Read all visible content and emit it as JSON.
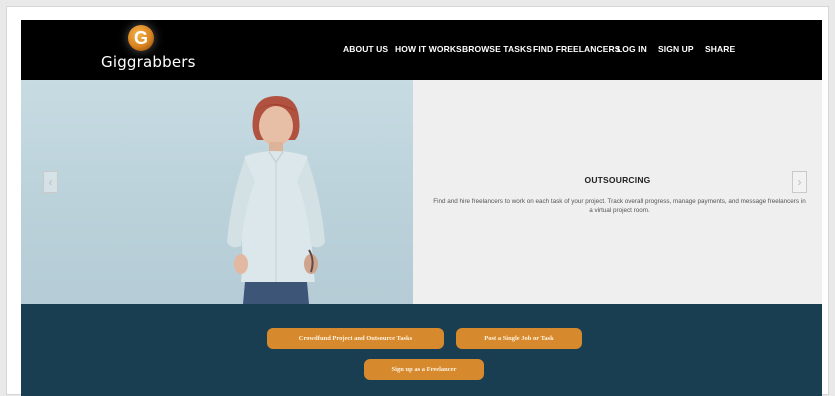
{
  "brand": {
    "logo_letter": "G",
    "name": "Giggrabbers"
  },
  "nav": {
    "items": [
      {
        "label": "ABOUT US"
      },
      {
        "label": "HOW IT WORKS"
      },
      {
        "label": "BROWSE TASKS"
      },
      {
        "label": "FIND FREELANCERS"
      },
      {
        "label": "LOG IN"
      },
      {
        "label": "SIGN UP"
      },
      {
        "label": "SHARE"
      }
    ]
  },
  "hero": {
    "title": "OUTSOURCING",
    "description": "Find and hire freelancers to work on each task of your project. Track overall progress, manage payments, and message freelancers in a virtual project room.",
    "prev_icon": "chevron-left-icon",
    "next_icon": "chevron-right-icon",
    "prev_glyph": "‹",
    "next_glyph": "›"
  },
  "cta": {
    "crowdfund": "Crowdfund Project and Outsource Tasks",
    "single_job": "Post a Single Job or Task",
    "signup": "Sign up as a Freelancer"
  },
  "colors": {
    "header_bg": "#000000",
    "band_bg": "#193d51",
    "button_bg": "#d6892d",
    "slide_bg": "#efefef"
  }
}
